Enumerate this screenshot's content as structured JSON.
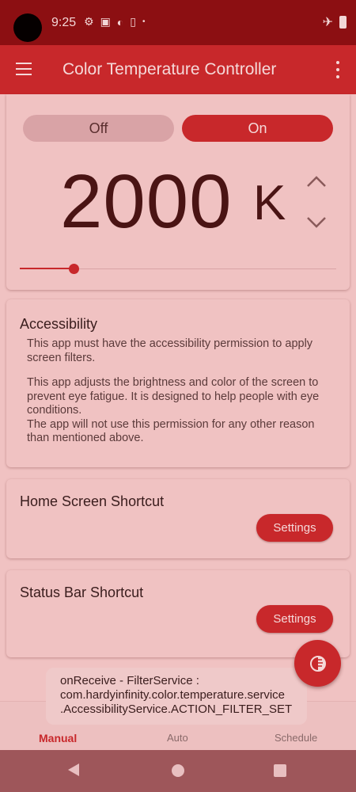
{
  "status_bar": {
    "time": "9:25",
    "icons": [
      "gear-icon",
      "image-icon",
      "contrast-icon",
      "sim-icon",
      "dot-icon",
      "airplane-icon",
      "battery-icon"
    ]
  },
  "app_bar": {
    "title": "Color Temperature Controller"
  },
  "main_card": {
    "off_label": "Off",
    "on_label": "On",
    "temperature_value": "2000",
    "temperature_unit": "K",
    "slider_level": 0.17
  },
  "accessibility": {
    "title": "Accessibility",
    "paragraph1": "This app must have the accessibility permission to apply screen filters.",
    "paragraph2": "This app adjusts the brightness and color of the screen to prevent eye fatigue. It is designed to help people with eye conditions.",
    "paragraph3": "The app will not use this permission for any other reason than mentioned above."
  },
  "home_shortcut": {
    "title": "Home Screen Shortcut",
    "button_label": "Settings"
  },
  "status_shortcut": {
    "title": "Status Bar Shortcut",
    "button_label": "Settings"
  },
  "toast": {
    "line1": "onReceive - FilterService :",
    "line2": "com.hardyinfinity.color.temperature.service",
    "line3": ".AccessibilityService.ACTION_FILTER_SET"
  },
  "bottom_nav": {
    "manual": "Manual",
    "auto": "Auto",
    "schedule": "Schedule"
  },
  "colors": {
    "accent": "#c8282b",
    "status_bar": "#8c0f12",
    "background": "#f0c2c2"
  }
}
